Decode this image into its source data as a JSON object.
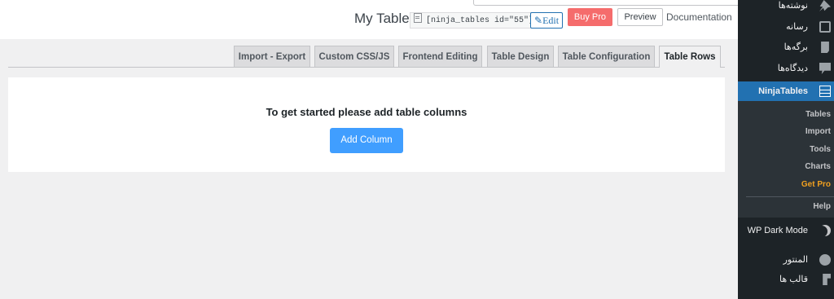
{
  "header": {
    "title": "My Table",
    "shortcode": "[ninja_tables id=\"55\"]",
    "edit_label": "Edit",
    "buy_pro_label": "Buy Pro",
    "preview_label": "Preview",
    "documentation_label": "Documentation"
  },
  "tabs": [
    {
      "label": "Import - Export",
      "active": false
    },
    {
      "label": "Custom CSS/JS",
      "active": false
    },
    {
      "label": "Frontend Editing",
      "active": false
    },
    {
      "label": "Table Design",
      "active": false
    },
    {
      "label": "Table Configuration",
      "active": false
    },
    {
      "label": "Table Rows",
      "active": true
    }
  ],
  "content": {
    "message": "To get started please add table columns",
    "add_column_label": "Add Column"
  },
  "sidebar": {
    "items": [
      {
        "label": "نوشته‌ها",
        "icon": "pin-icon"
      },
      {
        "label": "رسانه",
        "icon": "media-icon"
      },
      {
        "label": "برگه‌ها",
        "icon": "pages-icon"
      },
      {
        "label": "دیدگاه‌ها",
        "icon": "comments-icon"
      },
      {
        "label": "NinjaTables",
        "icon": "table-icon",
        "active": true
      }
    ],
    "submenu": [
      {
        "label": "Tables"
      },
      {
        "label": "Import"
      },
      {
        "label": "Tools"
      },
      {
        "label": "Charts"
      },
      {
        "label": "Get Pro"
      },
      {
        "label": "Help"
      }
    ],
    "bottom_items": [
      {
        "label": "WP Dark Mode",
        "icon": "moon-icon"
      },
      {
        "label": "المنتور",
        "icon": "elementor-icon"
      },
      {
        "label": "قالب ها",
        "icon": "brush-icon"
      }
    ]
  },
  "colors": {
    "buy_pro": "#f56c6c",
    "add_column": "#409eff",
    "sidebar_bg": "#1d2327",
    "sidebar_active": "#2271b1",
    "get_pro": "#f0a020"
  }
}
